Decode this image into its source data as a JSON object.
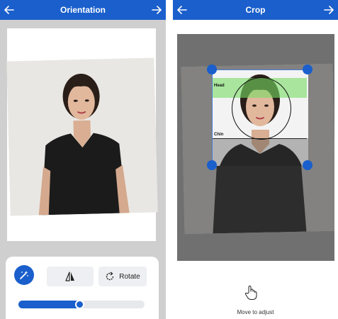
{
  "left": {
    "title": "Orientation",
    "rotate_label": "Rotate",
    "slider_value": 0.49
  },
  "right": {
    "title": "Crop",
    "head_label": "Head",
    "chin_label": "Chin",
    "hint": "Move to adjust"
  },
  "colors": {
    "accent": "#1a5fcc",
    "head_band": "#8edc78",
    "shirt": "#1b1b1b"
  },
  "icons": {
    "back": "arrow-left-icon",
    "forward": "arrow-right-icon",
    "magic": "magic-wand-icon",
    "flip": "flip-horizontal-icon",
    "rotate": "rotate-icon",
    "hand": "hand-pointer-icon"
  }
}
